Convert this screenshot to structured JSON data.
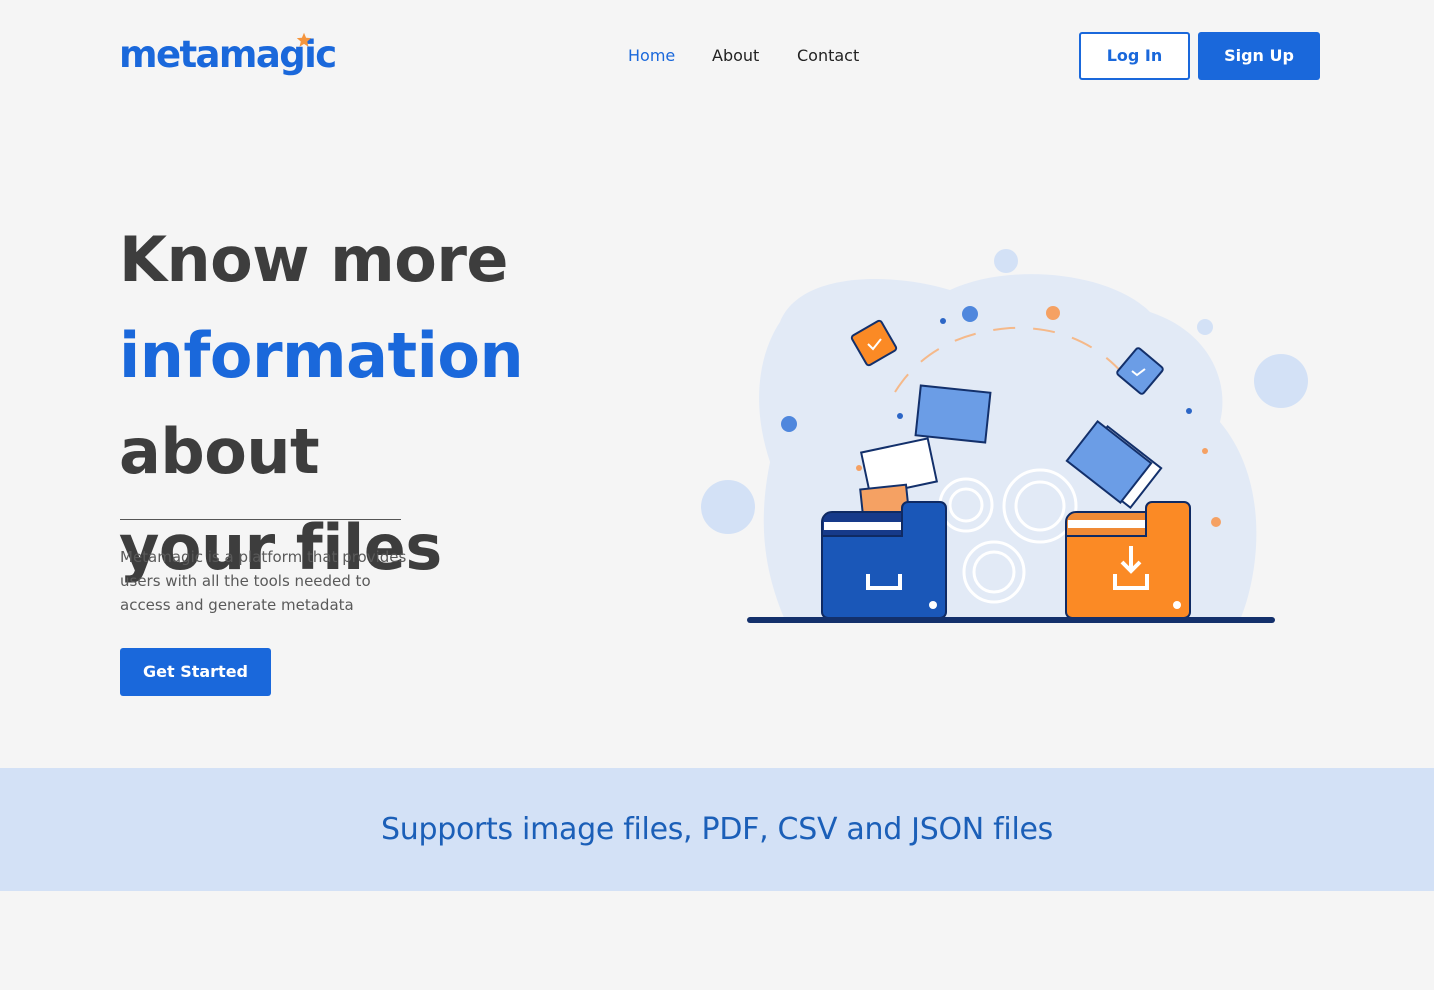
{
  "brand": {
    "name": "metamagic",
    "accent_color": "#1a68db",
    "star_color": "#f5953d"
  },
  "nav": {
    "items": [
      {
        "label": "Home",
        "active": true
      },
      {
        "label": "About",
        "active": false
      },
      {
        "label": "Contact",
        "active": false
      }
    ]
  },
  "auth": {
    "login_label": "Log In",
    "signup_label": "Sign Up"
  },
  "hero": {
    "title_line1": "Know more",
    "title_accent": "information",
    "title_line2_rest": " about",
    "title_line3": "your files",
    "description": "Metamagic is a platform that provides users with all the tools needed to access and generate metadata",
    "cta_label": "Get Started"
  },
  "banner": {
    "text": "Supports image files, PDF, CSV and JSON files"
  },
  "illustration": {
    "icons": [
      "upload-folder-icon",
      "download-folder-icon",
      "gear-icon",
      "document-icon",
      "checkbox-icon"
    ],
    "colors": {
      "blue": "#1a57b8",
      "light_blue": "#6b9de6",
      "orange": "#fb8a25",
      "blob": "#e2eaf6"
    }
  }
}
